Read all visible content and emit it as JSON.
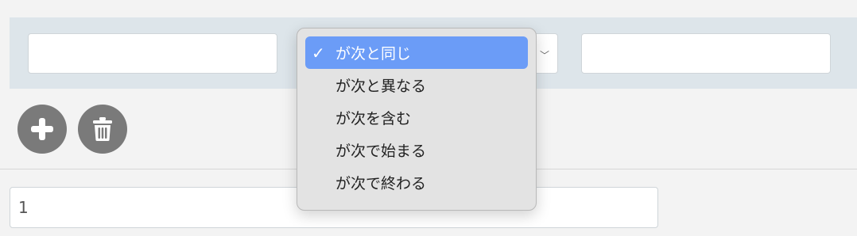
{
  "condition": {
    "left_value": "",
    "right_value": "",
    "operator_selected": "が次と同じ",
    "operator_options": [
      "が次と同じ",
      "が次と異なる",
      "が次を含む",
      "が次で始まる",
      "が次で終わる"
    ]
  },
  "actions": {
    "add_icon": "plus-icon",
    "delete_icon": "trash-icon"
  },
  "value_field": {
    "value": "1"
  },
  "colors": {
    "selected_background": "#6b9cf7",
    "row_background": "#dde5ea",
    "button_background": "#7a7a7a"
  }
}
